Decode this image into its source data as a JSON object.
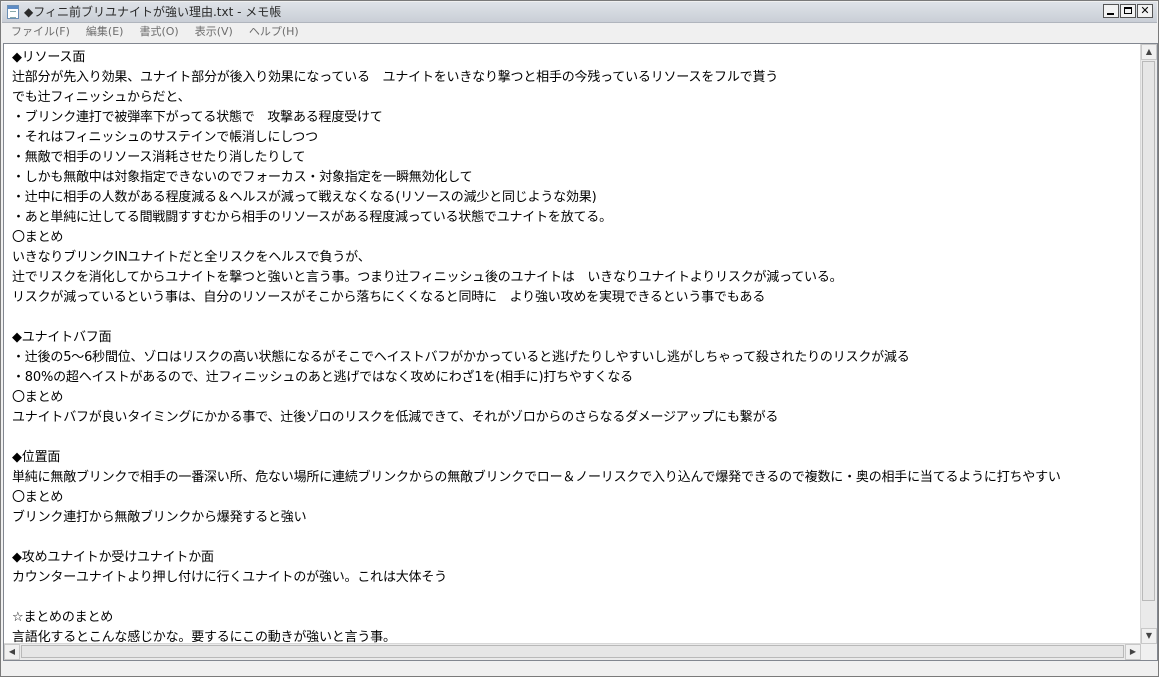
{
  "window": {
    "title": "◆フィニ前ブリユナイトが強い理由.txt - メモ帳",
    "icon": "notepad-icon"
  },
  "menu": [
    {
      "label": "ファイル(F)"
    },
    {
      "label": "編集(E)"
    },
    {
      "label": "書式(O)"
    },
    {
      "label": "表示(V)"
    },
    {
      "label": "ヘルプ(H)"
    }
  ],
  "document": {
    "lines": [
      "◆リソース面",
      "辻部分が先入り効果、ユナイト部分が後入り効果になっている　ユナイトをいきなり撃つと相手の今残っているリソースをフルで貰う",
      "でも辻フィニッシュからだと、",
      "・ブリンク連打で被弾率下がってる状態で　攻撃ある程度受けて",
      "・それはフィニッシュのサステインで帳消しにしつつ",
      "・無敵で相手のリソース消耗させたり消したりして",
      "・しかも無敵中は対象指定できないのでフォーカス・対象指定を一瞬無効化して",
      "・辻中に相手の人数がある程度減る＆ヘルスが減って戦えなくなる(リソースの減少と同じような効果)",
      "・あと単純に辻してる間戦闘すすむから相手のリソースがある程度減っている状態でユナイトを放てる。",
      "〇まとめ",
      "いきなりブリンクINユナイトだと全リスクをヘルスで負うが、",
      "辻でリスクを消化してからユナイトを撃つと強いと言う事。つまり辻フィニッシュ後のユナイトは　いきなりユナイトよりリスクが減っている。",
      "リスクが減っているという事は、自分のリソースがそこから落ちにくくなると同時に　より強い攻めを実現できるという事でもある",
      "",
      "◆ユナイトバフ面",
      "・辻後の5～6秒間位、ゾロはリスクの高い状態になるがそこでヘイストバフがかかっていると逃げたりしやすいし逃がしちゃって殺されたりのリスクが減る",
      "・80%の超ヘイストがあるので、辻フィニッシュのあと逃げではなく攻めにわざ1を(相手に)打ちやすくなる",
      "〇まとめ",
      "ユナイトバフが良いタイミングにかかる事で、辻後ゾロのリスクを低減できて、それがゾロからのさらなるダメージアップにも繋がる",
      "",
      "◆位置面",
      "単純に無敵ブリンクで相手の一番深い所、危ない場所に連続ブリンクからの無敵ブリンクでロー＆ノーリスクで入り込んで爆発できるので複数に・奥の相手に当てるように打ちやすい",
      "〇まとめ",
      "ブリンク連打から無敵ブリンクから爆発すると強い",
      "",
      "◆攻めユナイトか受けユナイトか面",
      "カウンターユナイトより押し付けに行くユナイトのが強い。これは大体そう",
      "",
      "☆まとめのまとめ",
      "言語化するとこんな感じかな。要するにこの動きが強いと言う事。"
    ]
  }
}
